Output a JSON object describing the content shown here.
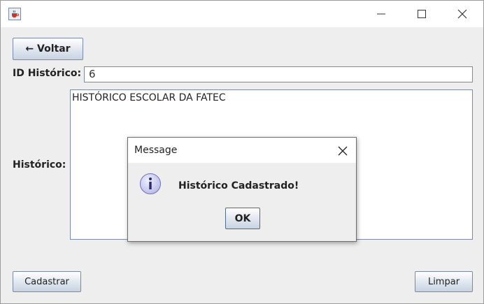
{
  "window": {
    "title": "",
    "app_icon": "java-coffee-icon",
    "controls": [
      "minimize-icon",
      "maximize-icon",
      "close-icon"
    ]
  },
  "form": {
    "back_button": "← Voltar",
    "id_label": "ID Histórico:",
    "id_value": "6",
    "historico_label": "Histórico:",
    "historico_value": "HISTÓRICO ESCOLAR DA FATEC",
    "save_button": "Cadastrar",
    "clear_button": "Limpar"
  },
  "dialog": {
    "title": "Message",
    "icon": "info-icon",
    "message": "Histórico Cadastrado!",
    "ok_button": "OK"
  },
  "colors": {
    "info_icon_fill": "#c6c8f0",
    "button_border": "#7a8aa6"
  }
}
